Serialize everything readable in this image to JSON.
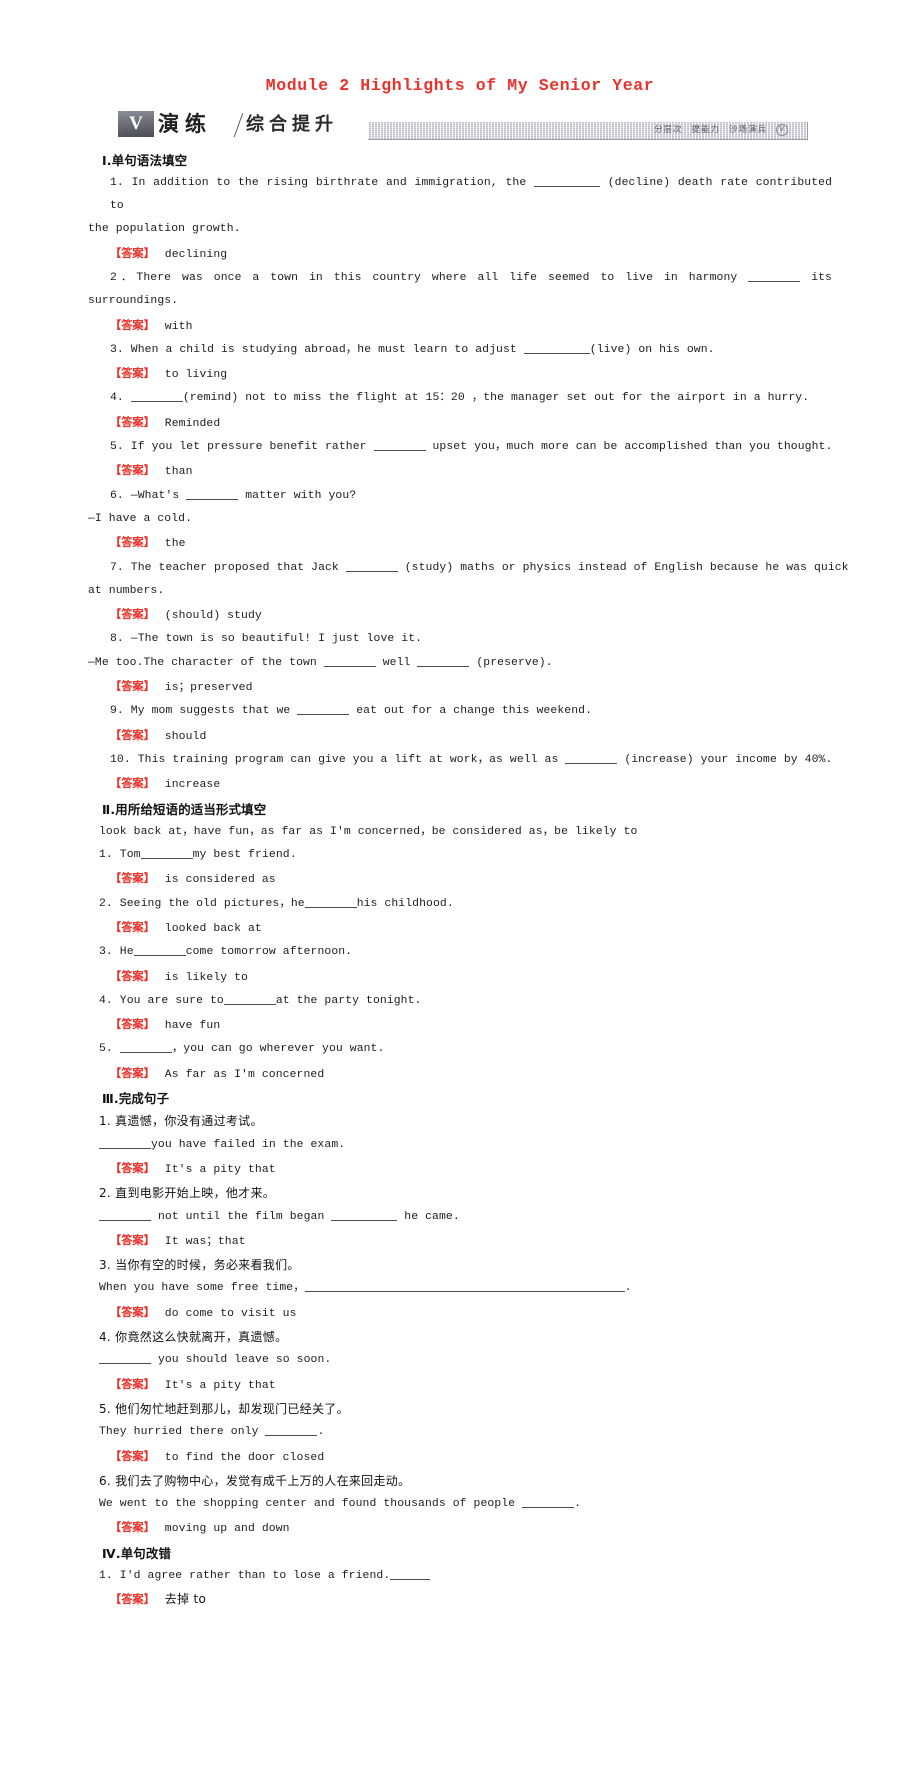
{
  "header": {
    "module_title": "Module 2 Highlights of My Senior Year",
    "banner": {
      "roman": "V",
      "main_cn": "演练",
      "sub_cn": "综合提升",
      "tags": [
        "分层次",
        "提能力",
        "沙场演兵"
      ],
      "badge": "V"
    }
  },
  "sections": [
    {
      "heading": "Ⅰ.单句语法填空",
      "items": [
        {
          "q1": "1. In addition to the rising birthrate and immigration, the",
          "q2": "(decline) death rate contributed to",
          "q3": "the population growth.",
          "ans_tag": "【答案】",
          "ans": "declining"
        },
        {
          "q1": "2．There was once a town in this country where all life seemed to live in harmony",
          "q2": "its",
          "q3": "surroundings.",
          "ans_tag": "【答案】",
          "ans": "with"
        },
        {
          "q1": "3. When a child is studying abroad，he must learn to adjust",
          "q2": "(live) on his own.",
          "ans_tag": "【答案】",
          "ans": "to living"
        },
        {
          "q1": "4.",
          "q2": "(remind) not to miss the flight at 15：20 ，the   manager set out for the airport in a hurry.",
          "ans_tag": "【答案】",
          "ans": "Reminded"
        },
        {
          "q1": "5. If you let pressure benefit rather",
          "q2": "upset you，much more can be accomplished than you thought.",
          "ans_tag": "【答案】",
          "ans": "than"
        },
        {
          "q1": "6. —What's",
          "q2": "matter with you?",
          "q3": "—I have a cold.",
          "ans_tag": "【答案】",
          "ans": "the"
        },
        {
          "q1": "7. The teacher proposed that Jack",
          "q2": "(study) maths or physics instead of English because he was quick",
          "q3": "at numbers.",
          "ans_tag": "【答案】",
          "ans": "(should) study"
        },
        {
          "q1": "8. —The town is so beautiful! I just love it.",
          "q2": "—Me too.The character of the town",
          "q3": "well",
          "q4": "(preserve).",
          "ans_tag": "【答案】",
          "ans": "is；preserved"
        },
        {
          "q1": "9. My mom suggests that we",
          "q2": "eat out for a change this weekend.",
          "ans_tag": "【答案】",
          "ans": "should"
        },
        {
          "q1": "10. This training program can give you a lift at work，as well as",
          "q2": "(increase) your income by 40%.",
          "ans_tag": "【答案】",
          "ans": "increase"
        }
      ]
    },
    {
      "heading": "Ⅱ.用所给短语的适当形式填空",
      "word_bank": "look back at，have fun，as far as I'm concerned，be considered as，be likely to",
      "items": [
        {
          "q1": "1. Tom",
          "q2": "my best friend.",
          "ans_tag": "【答案】",
          "ans": "is considered as"
        },
        {
          "q1": "2. Seeing the old pictures，he",
          "q2": "his childhood.",
          "ans_tag": "【答案】",
          "ans": "looked back at"
        },
        {
          "q1": "3. He",
          "q2": "come tomorrow afternoon.",
          "ans_tag": "【答案】",
          "ans": "is likely to"
        },
        {
          "q1": "4. You are sure to",
          "q2": "at the party tonight.",
          "ans_tag": "【答案】",
          "ans": "have fun"
        },
        {
          "q1": "5.",
          "q2": "，you can go wherever you want.",
          "ans_tag": "【答案】",
          "ans": "As far as I'm concerned"
        }
      ]
    },
    {
      "heading": "Ⅲ.完成句子",
      "items": [
        {
          "cn": "1. 真遗憾，你没有通过考试。",
          "q1": "",
          "q2": "you have failed in the exam.",
          "ans_tag": "【答案】",
          "ans": "It's a pity that"
        },
        {
          "cn": "2. 直到电影开始上映，他才来。",
          "q1": "",
          "q2": "not until the film began",
          "q3": "he came.",
          "ans_tag": "【答案】",
          "ans": "It was；that"
        },
        {
          "cn": "3. 当你有空的时候，务必来看我们。",
          "q1": "When you have some free time，",
          "q2": ".",
          "ans_tag": "【答案】",
          "ans": "do come to visit us"
        },
        {
          "cn": "4. 你竟然这么快就离开，真遗憾。",
          "q1": "",
          "q2": "you should leave so soon.",
          "ans_tag": "【答案】",
          "ans": "It's a pity that"
        },
        {
          "cn": "5. 他们匆忙地赶到那儿，却发现门已经关了。",
          "q1": "They hurried there only",
          "q2": ".",
          "ans_tag": "【答案】",
          "ans": "to find the door closed"
        },
        {
          "cn": "6. 我们去了购物中心，发觉有成千上万的人在来回走动。",
          "q1": "We went to the shopping center and found thousands of people",
          "q2": ".",
          "ans_tag": "【答案】",
          "ans": "moving up and down"
        }
      ]
    },
    {
      "heading": "Ⅳ.单句改错",
      "items": [
        {
          "q1": "1. I'd agree rather than to lose a friend.",
          "q2": "",
          "ans_tag": "【答案】",
          "ans": "去掉 to"
        }
      ]
    }
  ],
  "colors": {
    "accent_red": "#e8322a",
    "text": "#1c1c1c"
  }
}
